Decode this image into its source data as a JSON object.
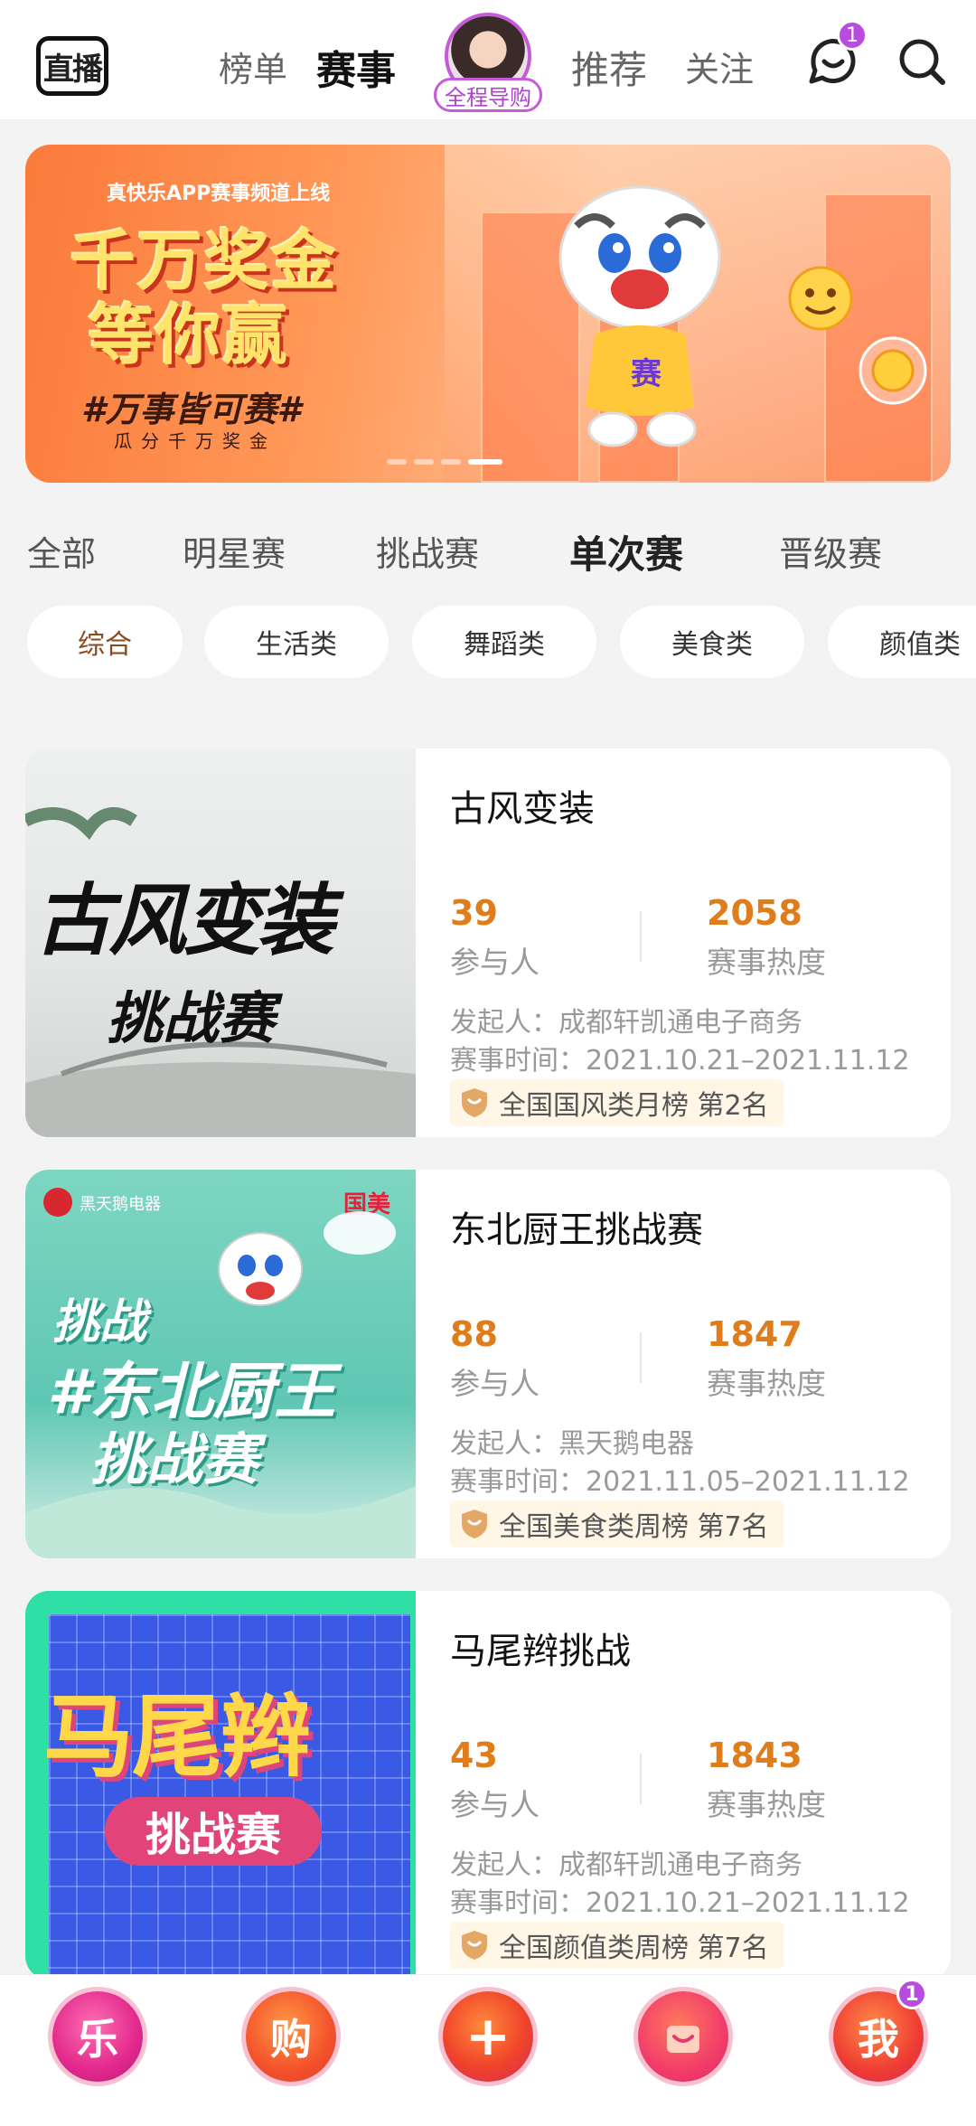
{
  "header": {
    "logo_text": "直播",
    "tabs": [
      {
        "label": "榜单"
      },
      {
        "label": "赛事",
        "active": true
      },
      {
        "label": "推荐"
      },
      {
        "label": "关注"
      }
    ],
    "guide_label": "全程导购",
    "message_badge": "1",
    "icons": [
      "message-icon",
      "search-icon"
    ]
  },
  "banner": {
    "subtitle": "真快乐APP赛事频道上线",
    "line1": "千万奖金",
    "line2": "等你赢",
    "slogan": "#万事皆可赛#",
    "tagline": "瓜分千万奖金",
    "tiger_text": "赛"
  },
  "category_tabs": [
    {
      "label": "全部"
    },
    {
      "label": "明星赛"
    },
    {
      "label": "挑战赛"
    },
    {
      "label": "单次赛",
      "active": true
    },
    {
      "label": "晋级赛"
    }
  ],
  "chips": [
    {
      "label": "综合",
      "active": true
    },
    {
      "label": "生活类"
    },
    {
      "label": "舞蹈类"
    },
    {
      "label": "美食类"
    },
    {
      "label": "颜值类"
    }
  ],
  "cards": [
    {
      "title": "古风变装",
      "participants": "39",
      "participants_label": "参与人",
      "heat": "2058",
      "heat_label": "赛事热度",
      "initiator": "发起人：成都轩凯通电子商务",
      "time": "赛事时间：2021.10.21–2021.11.12",
      "rank": "全国国风类月榜  第2名",
      "thumb_title": "古风变装",
      "thumb_sub": "挑战赛"
    },
    {
      "title": "东北厨王挑战赛",
      "participants": "88",
      "participants_label": "参与人",
      "heat": "1847",
      "heat_label": "赛事热度",
      "initiator": "发起人：黑天鹅电器",
      "time": "赛事时间：2021.11.05–2021.11.12",
      "rank": "全国美食类周榜  第7名",
      "thumb_l1": "挑战",
      "thumb_l2": "#东北厨王",
      "thumb_l3": "挑战赛",
      "thumb_brand_left": "黑天鹅电器",
      "thumb_brand_right": "国美"
    },
    {
      "title": "马尾辫挑战",
      "participants": "43",
      "participants_label": "参与人",
      "heat": "1843",
      "heat_label": "赛事热度",
      "initiator": "发起人：成都轩凯通电子商务",
      "time": "赛事时间：2021.10.21–2021.11.12",
      "rank": "全国颜值类周榜  第7名",
      "thumb_title": "马尾辫",
      "thumb_sub": "挑战赛"
    }
  ],
  "bottom_nav": [
    {
      "label": "乐"
    },
    {
      "label": "购"
    },
    {
      "label": "+"
    },
    {
      "label": ""
    },
    {
      "label": "我",
      "badge": "1"
    }
  ],
  "colors": {
    "accent_orange": "#e07c1a",
    "badge_purple": "#b84be0",
    "guide_purple": "#c55bd7"
  }
}
